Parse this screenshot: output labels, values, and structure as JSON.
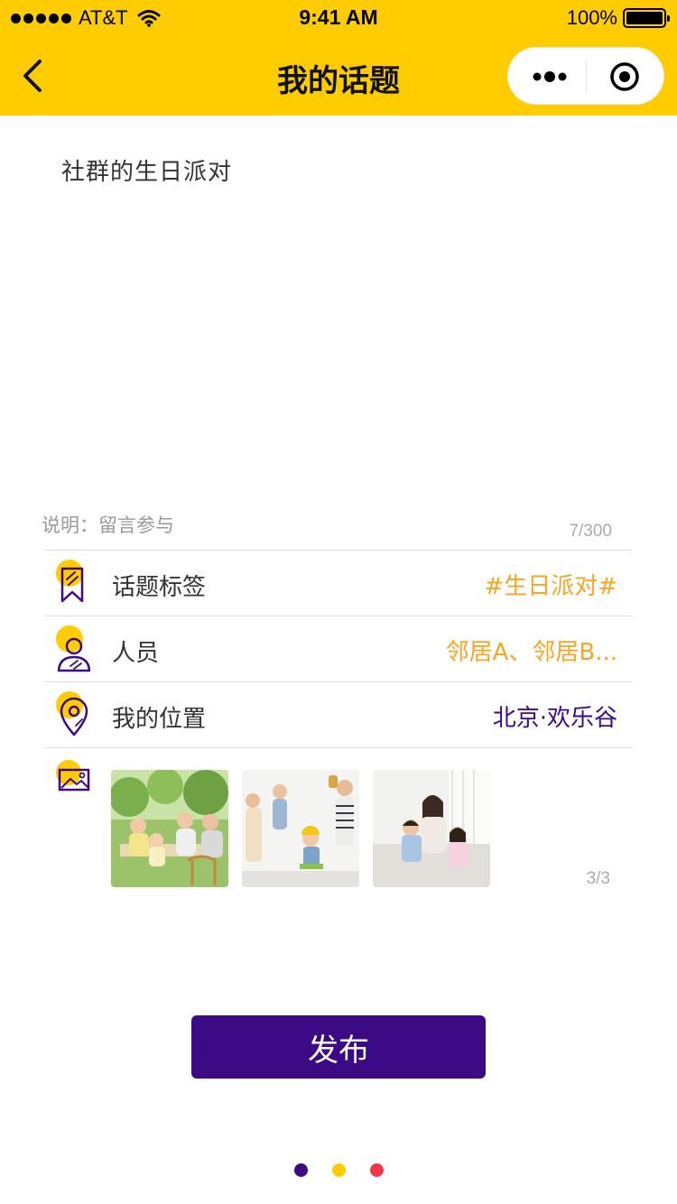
{
  "status_bar": {
    "carrier": "AT&T",
    "time": "9:41 AM",
    "battery": "100%"
  },
  "nav": {
    "title": "我的话题"
  },
  "topic": {
    "text": "社群的生日派对"
  },
  "description": {
    "label": "说明：留言参与",
    "count": "7/300"
  },
  "rows": [
    {
      "label": "话题标签",
      "value": "#生日派对#",
      "icon": "bookmark-icon",
      "value_color": "#F5A623"
    },
    {
      "label": "人员",
      "value": "邻居A、邻居B...",
      "icon": "person-icon",
      "value_color": "#F5A623"
    },
    {
      "label": "我的位置",
      "value": "北京·欢乐谷",
      "icon": "location-pin-icon",
      "value_color": "#3D0A85"
    }
  ],
  "photos": {
    "count": "3/3",
    "icon": "image-icon"
  },
  "publish_button": {
    "label": "发布"
  },
  "colors": {
    "brand_yellow": "#FFCC00",
    "brand_purple": "#3D0A85",
    "accent_orange": "#F5A623",
    "dot_red": "#F0364A"
  },
  "pager": {
    "dot_colors": [
      "#3D0A85",
      "#FFCC00",
      "#F0364A"
    ]
  }
}
